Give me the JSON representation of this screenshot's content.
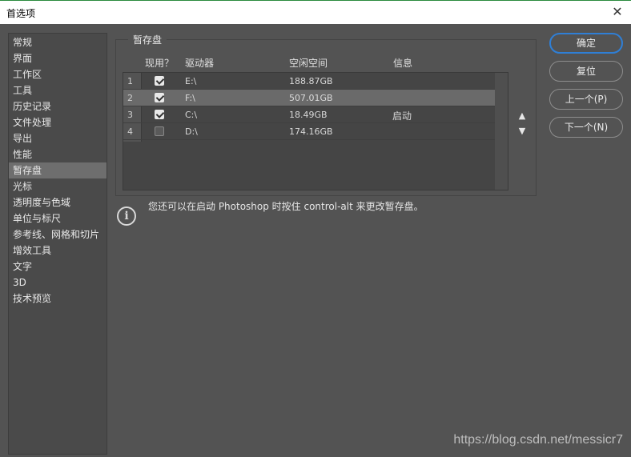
{
  "window": {
    "title": "首选项",
    "close_symbol": "✕"
  },
  "sidebar": {
    "items": [
      {
        "label": "常规"
      },
      {
        "label": "界面"
      },
      {
        "label": "工作区"
      },
      {
        "label": "工具"
      },
      {
        "label": "历史记录"
      },
      {
        "label": "文件处理"
      },
      {
        "label": "导出"
      },
      {
        "label": "性能"
      },
      {
        "label": "暂存盘",
        "selected": true
      },
      {
        "label": "光标"
      },
      {
        "label": "透明度与色域"
      },
      {
        "label": "单位与标尺"
      },
      {
        "label": "参考线、网格和切片"
      },
      {
        "label": "增效工具"
      },
      {
        "label": "文字"
      },
      {
        "label": "3D"
      },
      {
        "label": "技术预览"
      }
    ]
  },
  "scratch": {
    "group_title": "暂存盘",
    "columns": {
      "active": "现用？",
      "drive": "驱动器",
      "free": "空闲空间",
      "info": "信息"
    },
    "rows": [
      {
        "num": "1",
        "checked": true,
        "drive": "E:\\",
        "free": "188.87GB",
        "info": "",
        "selected": false
      },
      {
        "num": "2",
        "checked": true,
        "drive": "F:\\",
        "free": "507.01GB",
        "info": "",
        "selected": true
      },
      {
        "num": "3",
        "checked": true,
        "drive": "C:\\",
        "free": "18.49GB",
        "info": "启动",
        "selected": false
      },
      {
        "num": "4",
        "checked": false,
        "drive": "D:\\",
        "free": "174.16GB",
        "info": "",
        "selected": false
      }
    ],
    "move_up": "▲",
    "move_down": "▼"
  },
  "note": {
    "icon": "i",
    "text": "您还可以在启动 Photoshop 时按住 control-alt 来更改暂存盘。"
  },
  "buttons": {
    "ok": "确定",
    "reset": "复位",
    "prev": "上一个(P)",
    "next": "下一个(N)"
  },
  "watermark": "https://blog.csdn.net/messicr7",
  "colors": {
    "accent": "#2f7fd6",
    "background": "#535353",
    "selected_row": "#6a6a6a"
  }
}
